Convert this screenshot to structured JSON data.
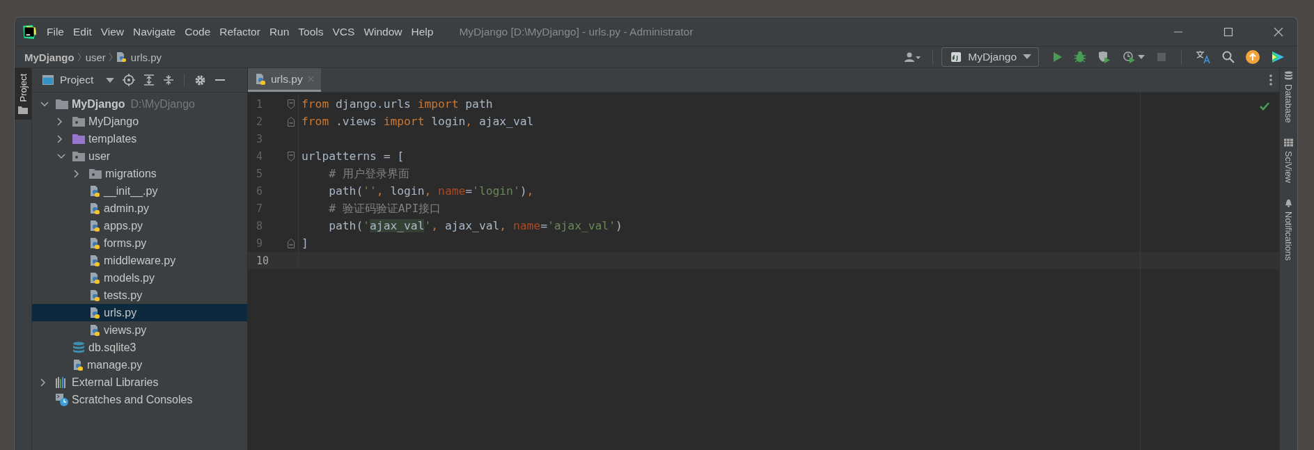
{
  "window": {
    "title": "MyDjango [D:\\MyDjango] - urls.py - Administrator"
  },
  "menu": [
    "File",
    "Edit",
    "View",
    "Navigate",
    "Code",
    "Refactor",
    "Run",
    "Tools",
    "VCS",
    "Window",
    "Help"
  ],
  "breadcrumbs": [
    {
      "label": "MyDjango",
      "kind": "project"
    },
    {
      "label": "user",
      "kind": "folder"
    },
    {
      "label": "urls.py",
      "kind": "python"
    }
  ],
  "run_config": {
    "label": "MyDjango"
  },
  "run_toolbar": [
    {
      "kind": "run",
      "disabled": false
    },
    {
      "kind": "debug",
      "disabled": false
    },
    {
      "kind": "coverage",
      "disabled": false
    },
    {
      "kind": "profile",
      "disabled": false
    },
    {
      "kind": "stop",
      "disabled": true
    }
  ],
  "tools_toolbar": [
    {
      "kind": "translate"
    },
    {
      "kind": "search"
    },
    {
      "kind": "update"
    },
    {
      "kind": "toolbox"
    }
  ],
  "left_stripe": [
    {
      "label": "Project",
      "selected": true
    }
  ],
  "project_panel": {
    "title": "Project",
    "tree": [
      {
        "label": "MyDjango",
        "path": "D:\\MyDjango",
        "kind": "root",
        "expanded": true,
        "selected": false,
        "children": [
          {
            "label": "MyDjango",
            "kind": "package",
            "expanded": false,
            "selected": false
          },
          {
            "label": "templates",
            "kind": "templates",
            "expanded": false,
            "selected": false
          },
          {
            "label": "user",
            "kind": "package",
            "expanded": true,
            "selected": false,
            "children": [
              {
                "label": "migrations",
                "kind": "package",
                "expanded": false,
                "selected": false
              },
              {
                "label": "__init__.py",
                "kind": "python",
                "selected": false
              },
              {
                "label": "admin.py",
                "kind": "python",
                "selected": false
              },
              {
                "label": "apps.py",
                "kind": "python",
                "selected": false
              },
              {
                "label": "forms.py",
                "kind": "python",
                "selected": false
              },
              {
                "label": "middleware.py",
                "kind": "python",
                "selected": false
              },
              {
                "label": "models.py",
                "kind": "python",
                "selected": false
              },
              {
                "label": "tests.py",
                "kind": "python",
                "selected": false
              },
              {
                "label": "urls.py",
                "kind": "python",
                "selected": true
              },
              {
                "label": "views.py",
                "kind": "python",
                "selected": false
              }
            ]
          },
          {
            "label": "db.sqlite3",
            "kind": "database",
            "selected": false
          },
          {
            "label": "manage.py",
            "kind": "python",
            "selected": false
          }
        ]
      },
      {
        "label": "External Libraries",
        "kind": "libraries",
        "expanded": false,
        "selected": false
      },
      {
        "label": "Scratches and Consoles",
        "kind": "scratches",
        "selected": false
      }
    ]
  },
  "editor": {
    "tabs": [
      {
        "label": "urls.py",
        "selected": true
      }
    ],
    "lines": [
      {
        "number": "1",
        "kind": "fold-start",
        "current": false,
        "tokens": [
          {
            "kind": "keyword",
            "text": "from"
          },
          {
            "kind": "plain",
            "text": " django.urls "
          },
          {
            "kind": "keyword",
            "text": "import"
          },
          {
            "kind": "plain",
            "text": " path"
          }
        ]
      },
      {
        "number": "2",
        "kind": "fold-end",
        "current": false,
        "tokens": [
          {
            "kind": "keyword",
            "text": "from"
          },
          {
            "kind": "plain",
            "text": " .views "
          },
          {
            "kind": "keyword",
            "text": "import"
          },
          {
            "kind": "plain",
            "text": " login"
          },
          {
            "kind": "keyword",
            "text": ", "
          },
          {
            "kind": "plain",
            "text": "ajax_val"
          }
        ]
      },
      {
        "number": "3",
        "kind": "plain",
        "current": false
      },
      {
        "number": "4",
        "kind": "fold-start",
        "current": false,
        "tokens": [
          {
            "kind": "plain",
            "text": "urlpatterns = ["
          }
        ]
      },
      {
        "number": "5",
        "kind": "plain",
        "current": false,
        "tokens": [
          {
            "kind": "comment",
            "text": "    # 用户登录界面"
          }
        ]
      },
      {
        "number": "6",
        "kind": "plain",
        "current": false,
        "tokens": [
          {
            "kind": "plain",
            "text": "    path("
          },
          {
            "kind": "string",
            "text": "''"
          },
          {
            "kind": "keyword",
            "text": ", "
          },
          {
            "kind": "plain",
            "text": "login"
          },
          {
            "kind": "keyword",
            "text": ", "
          },
          {
            "kind": "param",
            "text": "name"
          },
          {
            "kind": "plain",
            "text": "="
          },
          {
            "kind": "string",
            "text": "'login'"
          },
          {
            "kind": "plain",
            "text": ")"
          },
          {
            "kind": "keyword",
            "text": ","
          }
        ]
      },
      {
        "number": "7",
        "kind": "plain",
        "current": false,
        "tokens": [
          {
            "kind": "comment",
            "text": "    # 验证码验证API接口"
          }
        ]
      },
      {
        "number": "8",
        "kind": "plain",
        "current": false,
        "tokens": [
          {
            "kind": "plain",
            "text": "    path("
          },
          {
            "kind": "string",
            "text": "'"
          },
          {
            "kind": "highlight",
            "text": "ajax_val"
          },
          {
            "kind": "string",
            "text": "'"
          },
          {
            "kind": "keyword",
            "text": ", "
          },
          {
            "kind": "plain",
            "text": "ajax_val"
          },
          {
            "kind": "keyword",
            "text": ", "
          },
          {
            "kind": "param",
            "text": "name"
          },
          {
            "kind": "plain",
            "text": "="
          },
          {
            "kind": "string",
            "text": "'ajax_val'"
          },
          {
            "kind": "plain",
            "text": ")"
          }
        ]
      },
      {
        "number": "9",
        "kind": "fold-end",
        "current": false,
        "tokens": [
          {
            "kind": "plain",
            "text": "]"
          }
        ]
      },
      {
        "number": "10",
        "kind": "plain",
        "current": true
      }
    ]
  },
  "right_stripe": [
    {
      "label": "Database",
      "kind": "database"
    },
    {
      "label": "SciView",
      "kind": "grid"
    },
    {
      "label": "Notifications",
      "kind": "bell"
    }
  ]
}
